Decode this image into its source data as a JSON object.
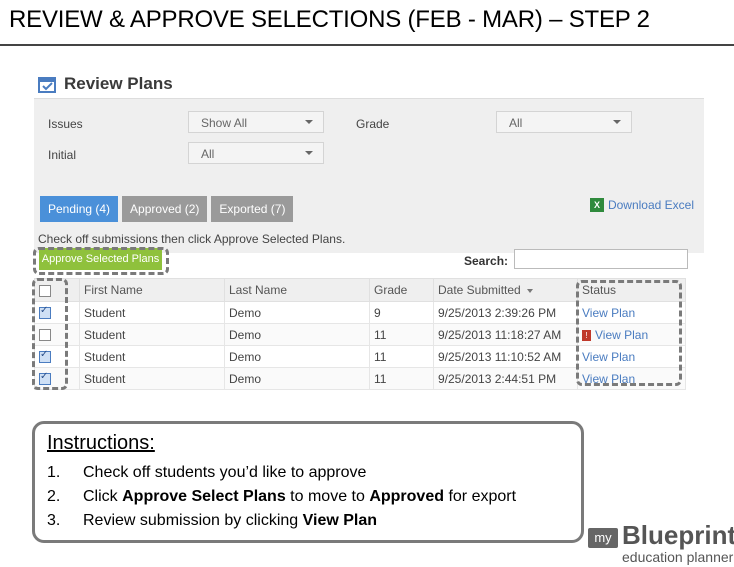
{
  "slide": {
    "title": "REVIEW & APPROVE SELECTIONS (FEB - MAR) – STEP 2"
  },
  "app": {
    "title": "Review Plans",
    "filters": {
      "issues_label": "Issues",
      "issues_value": "Show All",
      "grade_label": "Grade",
      "grade_value": "All",
      "initial_label": "Initial",
      "initial_value": "All"
    },
    "tabs": [
      {
        "label": "Pending (4)",
        "active": true
      },
      {
        "label": "Approved (2)",
        "active": false
      },
      {
        "label": "Exported (7)",
        "active": false
      }
    ],
    "download_label": "Download Excel",
    "hint": "Check off submissions then click Approve Selected Plans.",
    "approve_button": "Approve Selected Plans",
    "search_label": "Search:",
    "columns": [
      "First Name",
      "Last Name",
      "Grade",
      "Date Submitted",
      "Status"
    ],
    "rows": [
      {
        "checked": true,
        "first": "Student",
        "last": "Demo",
        "grade": "9",
        "date": "9/25/2013 2:39:26 PM",
        "status": "View Plan",
        "flag": false
      },
      {
        "checked": false,
        "first": "Student",
        "last": "Demo",
        "grade": "11",
        "date": "9/25/2013 11:18:27 AM",
        "status": "View Plan",
        "flag": true
      },
      {
        "checked": true,
        "first": "Student",
        "last": "Demo",
        "grade": "11",
        "date": "9/25/2013 11:10:52 AM",
        "status": "View Plan",
        "flag": false
      },
      {
        "checked": true,
        "first": "Student",
        "last": "Demo",
        "grade": "11",
        "date": "9/25/2013 2:44:51 PM",
        "status": "View Plan",
        "flag": false
      }
    ]
  },
  "instructions": {
    "title": "Instructions:",
    "items": [
      {
        "num": "1.",
        "parts": [
          {
            "text": "Check off students you’d like to approve",
            "bold": false
          }
        ]
      },
      {
        "num": "2.",
        "parts": [
          {
            "text": "Click ",
            "bold": false
          },
          {
            "text": "Approve Select Plans",
            "bold": true
          },
          {
            "text": " to move to ",
            "bold": false
          },
          {
            "text": "Approved",
            "bold": true
          },
          {
            "text": " for export",
            "bold": false
          }
        ]
      },
      {
        "num": "3.",
        "parts": [
          {
            "text": "Review submission by clicking ",
            "bold": false
          },
          {
            "text": "View Plan",
            "bold": true
          }
        ]
      }
    ]
  },
  "logo": {
    "my": "my",
    "brand": "Blueprint",
    "tagline": "education planner"
  },
  "colors": {
    "accent_blue": "#4a90d9",
    "approve_green": "#8fc13c",
    "link": "#4a7cc0"
  }
}
